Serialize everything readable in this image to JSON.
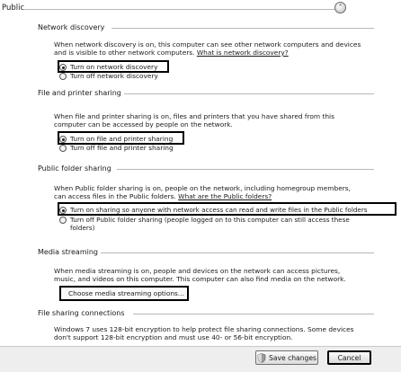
{
  "profile": {
    "title": "Public",
    "collapse_icon": "chevron-up-icon"
  },
  "network_discovery": {
    "heading": "Network discovery",
    "description": "When network discovery is on, this computer can see other network computers and devices and is visible to other network computers.",
    "link": "What is network discovery?",
    "options": [
      "Turn on network discovery",
      "Turn off network discovery"
    ],
    "selected": 0
  },
  "file_printer_sharing": {
    "heading": "File and printer sharing",
    "description": "When file and printer sharing is on, files and printers that you have shared from this computer can be accessed by people on the network.",
    "options": [
      "Turn on file and printer sharing",
      "Turn off file and printer sharing"
    ],
    "selected": 0
  },
  "public_folder_sharing": {
    "heading": "Public folder sharing",
    "description": "When Public folder sharing is on, people on the network, including homegroup members, can access files in the Public folders.",
    "link": "What are the Public folders?",
    "options": [
      "Turn on sharing so anyone with network access can read and write files in the Public folders",
      "Turn off Public folder sharing (people logged on to this computer can still access these folders)"
    ],
    "selected": 0
  },
  "media_streaming": {
    "heading": "Media streaming",
    "description": "When media streaming is on, people and devices on the network can access pictures, music, and videos on this computer. This computer can also find media on the network.",
    "button": "Choose media streaming options..."
  },
  "file_sharing_connections": {
    "heading": "File sharing connections",
    "description": "Windows 7 uses 128-bit encryption to help protect file sharing connections. Some devices don't support 128-bit encryption and must use 40- or 56-bit encryption."
  },
  "footer": {
    "save_label": "Save changes",
    "cancel_label": "Cancel",
    "save_icon": "shield-icon"
  }
}
